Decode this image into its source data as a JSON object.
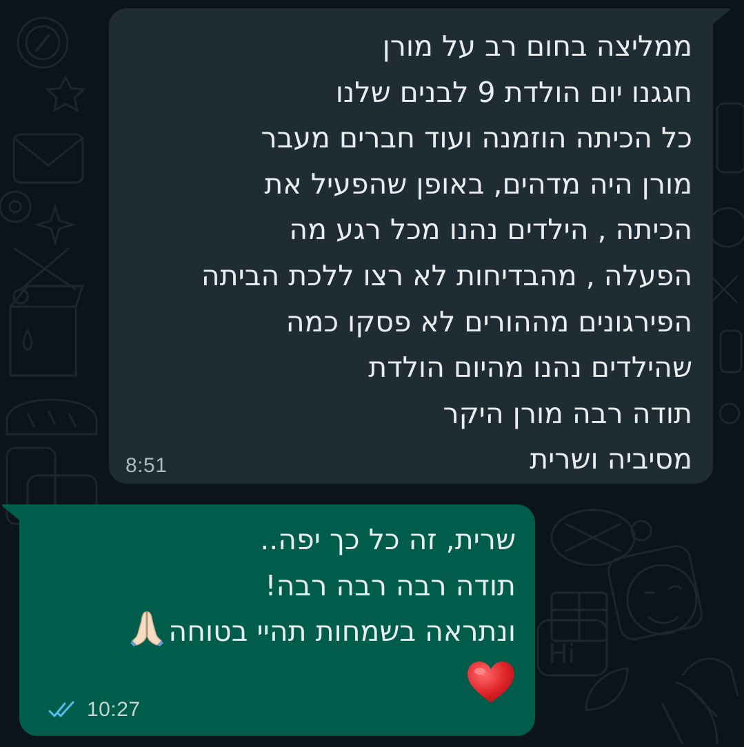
{
  "incoming_message": {
    "lines": [
      "ממליצה בחום רב על מורן",
      "חגגנו יום הולדת 9 לבנים שלנו",
      "כל הכיתה הוזמנה ועוד חברים מעבר",
      "מורן היה מדהים, באופן שהפעיל את",
      "הכיתה , הילדים נהנו מכל רגע מה",
      "הפעלה , מהבדיחות לא רצו ללכת הביתה",
      "הפירגונים מההורים לא פסקו כמה",
      "שהילדים נהנו מהיום הולדת",
      "תודה רבה מורן היקר",
      "מסיביה ושרית"
    ],
    "time": "8:51"
  },
  "outgoing_message": {
    "lines": [
      "שרית, זה כל כך יפה..",
      "תודה רבה רבה רבה!",
      "ונתראה בשמחות תהיי בטוחה"
    ],
    "emoji_after_line3": "folded-hands",
    "emoji_line": "red-heart",
    "time": "10:27",
    "status_icon": "double-check-read-icon"
  },
  "colors": {
    "background": "#0b141a",
    "incoming_bubble": "#202c33",
    "outgoing_bubble": "#005c4b",
    "text": "#e9edef",
    "timestamp": "#aebac1",
    "read_ticks": "#53bdeb"
  }
}
